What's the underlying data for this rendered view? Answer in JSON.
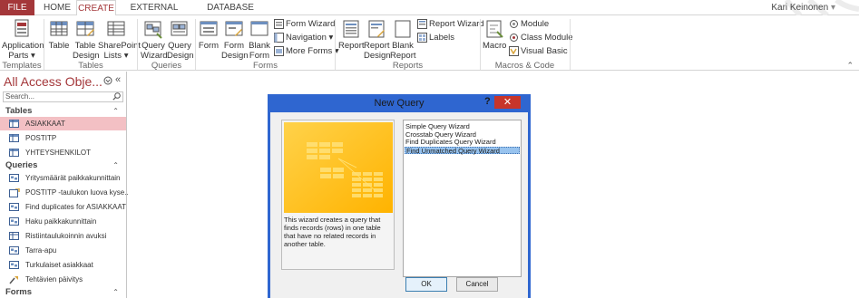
{
  "tabs": [
    "FILE",
    "HOME",
    "CREATE",
    "EXTERNAL DATA",
    "DATABASE TOOLS"
  ],
  "active_tab": "CREATE",
  "user_name": "Kari Keinonen",
  "user_chevron": "▾",
  "ribbon": {
    "templates": {
      "app_parts_line1": "Application",
      "app_parts_line2": "Parts",
      "group": "Templates"
    },
    "tables": {
      "table": "Table",
      "table_design_1": "Table",
      "table_design_2": "Design",
      "sharepoint_1": "SharePoint",
      "sharepoint_2": "Lists",
      "group": "Tables"
    },
    "queries": {
      "qw_1": "Query",
      "qw_2": "Wizard",
      "qd_1": "Query",
      "qd_2": "Design",
      "group": "Queries"
    },
    "forms": {
      "form": "Form",
      "fd_1": "Form",
      "fd_2": "Design",
      "bf_1": "Blank",
      "bf_2": "Form",
      "form_wizard": "Form Wizard",
      "navigation": "Navigation",
      "more_forms": "More Forms",
      "group": "Forms"
    },
    "reports": {
      "report": "Report",
      "rd_1": "Report",
      "rd_2": "Design",
      "br_1": "Blank",
      "br_2": "Report",
      "report_wizard": "Report Wizard",
      "labels": "Labels",
      "group": "Reports"
    },
    "macros": {
      "macro": "Macro",
      "module": "Module",
      "class_module": "Class Module",
      "visual_basic": "Visual Basic",
      "group": "Macros & Code"
    }
  },
  "nav": {
    "title": "All Access Obje...",
    "search_placeholder": "Search...",
    "sections": {
      "tables": "Tables",
      "queries": "Queries",
      "forms": "Forms"
    },
    "tables": [
      "ASIAKKAAT",
      "POSTITP",
      "YHTEYSHENKILOT"
    ],
    "queries": [
      "Yritysmäärät paikkakunnittain",
      "POSTITP -taulukon luova kyse...",
      "Find duplicates for ASIAKKAAT",
      "Haku paikkakunnittain",
      "Ristiintaulukoinnin avuksi",
      "Tarra-apu",
      "Turkulaiset asiakkaat",
      "Tehtävien päivitys"
    ]
  },
  "dialog": {
    "title": "New Query",
    "help": "?",
    "close": "✕",
    "description": "This wizard creates a query that finds records (rows) in one table that have no related records in another table.",
    "options": [
      "Simple Query Wizard",
      "Crosstab Query Wizard",
      "Find Duplicates Query Wizard",
      "Find Unmatched Query Wizard"
    ],
    "selected_option": "Find Unmatched Query Wizard",
    "ok": "OK",
    "cancel": "Cancel"
  },
  "colors": {
    "access_red": "#a4373a",
    "dialog_blue": "#2f66d0",
    "close_red": "#c7352b",
    "selection": "#f3c0c4",
    "wizard_yellow": "#ffc21a"
  }
}
